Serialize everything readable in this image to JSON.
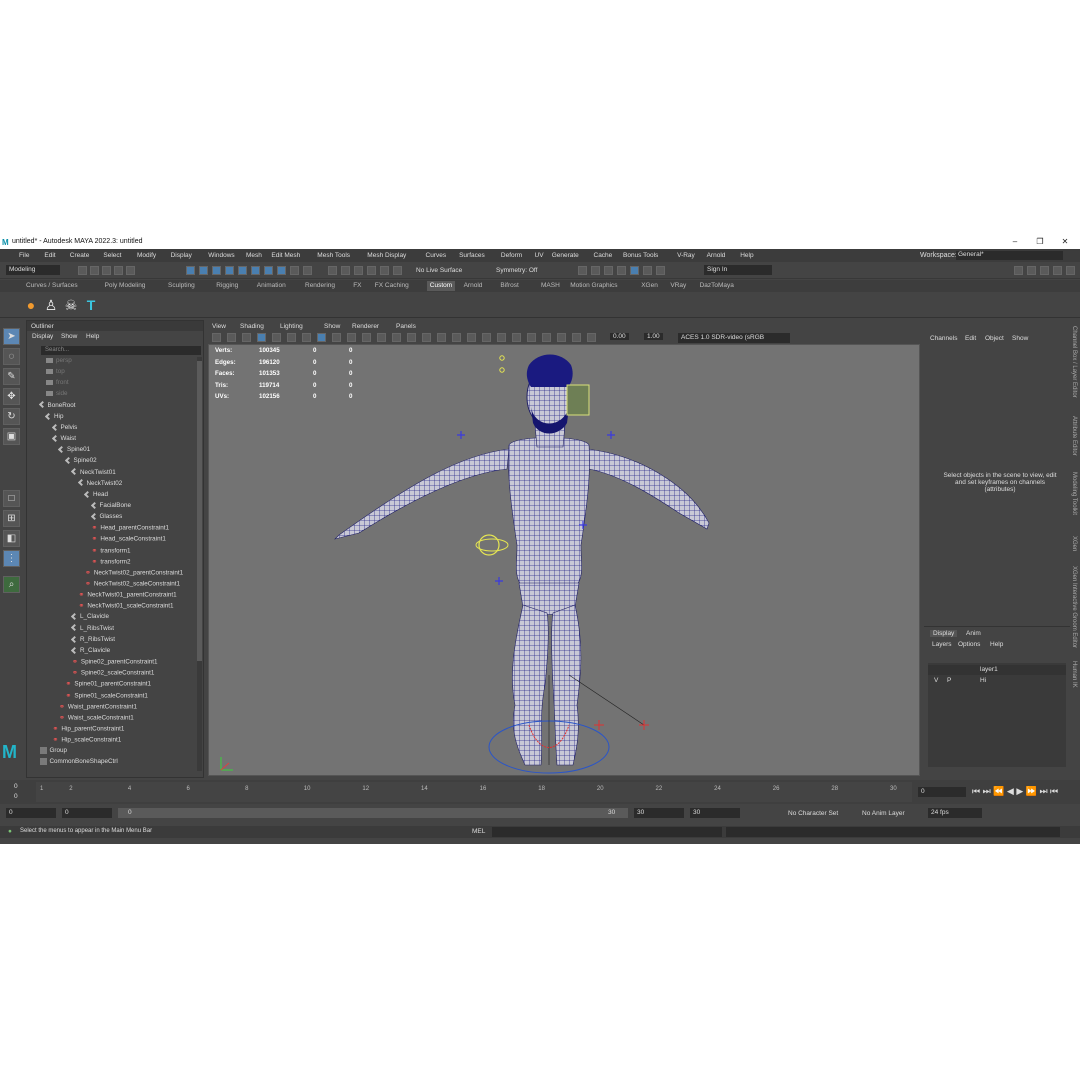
{
  "titlebar": {
    "title": "untitled* - Autodesk MAYA 2022.3: untitled",
    "logo": "M",
    "min": "–",
    "max": "❐",
    "close": "✕"
  },
  "menubar": {
    "items": [
      "File",
      "Edit",
      "Create",
      "Select",
      "Modify",
      "Display",
      "Windows",
      "Mesh",
      "Edit Mesh",
      "Mesh Tools",
      "Mesh Display",
      "Curves",
      "Surfaces",
      "Deform",
      "UV",
      "Generate",
      "Cache",
      "Bonus Tools",
      "V-Ray",
      "Arnold",
      "Help"
    ],
    "workspace_label": "Workspace:",
    "workspace_value": "General*"
  },
  "statusline": {
    "mode": "Modeling",
    "live_surface": "No Live Surface",
    "symmetry": "Symmetry: Off",
    "sign_in": "Sign In"
  },
  "shelf": {
    "tabs": [
      "Curves / Surfaces",
      "Poly Modeling",
      "Sculpting",
      "Rigging",
      "Animation",
      "Rendering",
      "FX",
      "FX Caching",
      "Custom",
      "Arnold",
      "Bifrost",
      "MASH",
      "Motion Graphics",
      "XGen",
      "VRay",
      "DazToMaya"
    ],
    "active_tab": "Custom",
    "icons": [
      "daz-logo-icon",
      "figure-icon",
      "skull-icon",
      "tpose-icon"
    ]
  },
  "outliner": {
    "title": "Outliner",
    "menu": [
      "Display",
      "Show",
      "Help"
    ],
    "search_placeholder": "Search...",
    "items": [
      {
        "label": "persp",
        "depth": 2,
        "kind": "cam",
        "dim": true
      },
      {
        "label": "top",
        "depth": 2,
        "kind": "cam",
        "dim": true
      },
      {
        "label": "front",
        "depth": 2,
        "kind": "cam",
        "dim": true
      },
      {
        "label": "side",
        "depth": 2,
        "kind": "cam",
        "dim": true
      },
      {
        "label": "BoneRoot",
        "depth": 1,
        "kind": "joint"
      },
      {
        "label": "Hip",
        "depth": 2,
        "kind": "joint"
      },
      {
        "label": "Pelvis",
        "depth": 3,
        "kind": "joint"
      },
      {
        "label": "Waist",
        "depth": 3,
        "kind": "joint"
      },
      {
        "label": "Spine01",
        "depth": 4,
        "kind": "joint"
      },
      {
        "label": "Spine02",
        "depth": 5,
        "kind": "joint"
      },
      {
        "label": "NeckTwist01",
        "depth": 6,
        "kind": "joint"
      },
      {
        "label": "NeckTwist02",
        "depth": 7,
        "kind": "joint"
      },
      {
        "label": "Head",
        "depth": 8,
        "kind": "joint"
      },
      {
        "label": "FacialBone",
        "depth": 9,
        "kind": "joint"
      },
      {
        "label": "Glasses",
        "depth": 9,
        "kind": "joint"
      },
      {
        "label": "Head_parentConstraint1",
        "depth": 9,
        "kind": "cons"
      },
      {
        "label": "Head_scaleConstraint1",
        "depth": 9,
        "kind": "cons"
      },
      {
        "label": "transform1",
        "depth": 9,
        "kind": "cons"
      },
      {
        "label": "transform2",
        "depth": 9,
        "kind": "cons"
      },
      {
        "label": "NeckTwist02_parentConstraint1",
        "depth": 8,
        "kind": "cons"
      },
      {
        "label": "NeckTwist02_scaleConstraint1",
        "depth": 8,
        "kind": "cons"
      },
      {
        "label": "NeckTwist01_parentConstraint1",
        "depth": 7,
        "kind": "cons"
      },
      {
        "label": "NeckTwist01_scaleConstraint1",
        "depth": 7,
        "kind": "cons"
      },
      {
        "label": "L_Clavicle",
        "depth": 6,
        "kind": "joint"
      },
      {
        "label": "L_RibsTwist",
        "depth": 6,
        "kind": "joint"
      },
      {
        "label": "R_RibsTwist",
        "depth": 6,
        "kind": "joint"
      },
      {
        "label": "R_Clavicle",
        "depth": 6,
        "kind": "joint"
      },
      {
        "label": "Spine02_parentConstraint1",
        "depth": 6,
        "kind": "cons"
      },
      {
        "label": "Spine02_scaleConstraint1",
        "depth": 6,
        "kind": "cons"
      },
      {
        "label": "Spine01_parentConstraint1",
        "depth": 5,
        "kind": "cons"
      },
      {
        "label": "Spine01_scaleConstraint1",
        "depth": 5,
        "kind": "cons"
      },
      {
        "label": "Waist_parentConstraint1",
        "depth": 4,
        "kind": "cons"
      },
      {
        "label": "Waist_scaleConstraint1",
        "depth": 4,
        "kind": "cons"
      },
      {
        "label": "Hip_parentConstraint1",
        "depth": 3,
        "kind": "cons"
      },
      {
        "label": "Hip_scaleConstraint1",
        "depth": 3,
        "kind": "cons"
      },
      {
        "label": "Group",
        "depth": 1,
        "kind": "grp"
      },
      {
        "label": "CommonBoneShapeCtrl",
        "depth": 1,
        "kind": "grp"
      }
    ]
  },
  "viewport": {
    "menu": [
      "View",
      "Shading",
      "Lighting",
      "Show",
      "Renderer",
      "Panels"
    ],
    "exposure": "0.00",
    "gamma": "1.00",
    "color_space": "ACES 1.0 SDR-video (sRGB",
    "hud": [
      {
        "label": "Verts:",
        "v1": "100345",
        "v2": "0",
        "v3": "0"
      },
      {
        "label": "Edges:",
        "v1": "196120",
        "v2": "0",
        "v3": "0"
      },
      {
        "label": "Faces:",
        "v1": "101353",
        "v2": "0",
        "v3": "0"
      },
      {
        "label": "Tris:",
        "v1": "119714",
        "v2": "0",
        "v3": "0"
      },
      {
        "label": "UVs:",
        "v1": "102156",
        "v2": "0",
        "v3": "0"
      }
    ]
  },
  "channelbox": {
    "menu": [
      "Channels",
      "Edit",
      "Object",
      "Show"
    ],
    "info": "Select objects in the scene to view, edit and set keyframes on channels (attributes)",
    "side_tabs": [
      "Channel Box / Layer Editor",
      "Attribute Editor",
      "Modeling Toolkit",
      "XGen",
      "XGen Interactive Groom Editor",
      "Human IK"
    ]
  },
  "layers": {
    "tabs": [
      "Display",
      "Anim"
    ],
    "menu": [
      "Layers",
      "Options",
      "Help"
    ],
    "rows": [
      {
        "v": "",
        "p": "",
        "name": "layer1"
      },
      {
        "v": "V",
        "p": "P",
        "name": "Hi"
      }
    ]
  },
  "timeline": {
    "ticks": [
      "1",
      "2",
      "4",
      "6",
      "8",
      "10",
      "12",
      "14",
      "16",
      "18",
      "20",
      "22",
      "24",
      "26",
      "28",
      "30"
    ],
    "current_frame": "0",
    "current_display": "0"
  },
  "range": {
    "start": "0",
    "start2": "0",
    "slider_start": "0",
    "slider_end": "30",
    "end": "30",
    "end2": "30",
    "char_set": "No Character Set",
    "anim_layer": "No Anim Layer",
    "fps": "24 fps"
  },
  "cmdline": {
    "help": "Select the menus to appear in the Main Menu Bar",
    "lang": "MEL"
  },
  "colors": {
    "accent": "#5c87b4",
    "mesh": "#2a2a8a",
    "bg": "#737373"
  }
}
